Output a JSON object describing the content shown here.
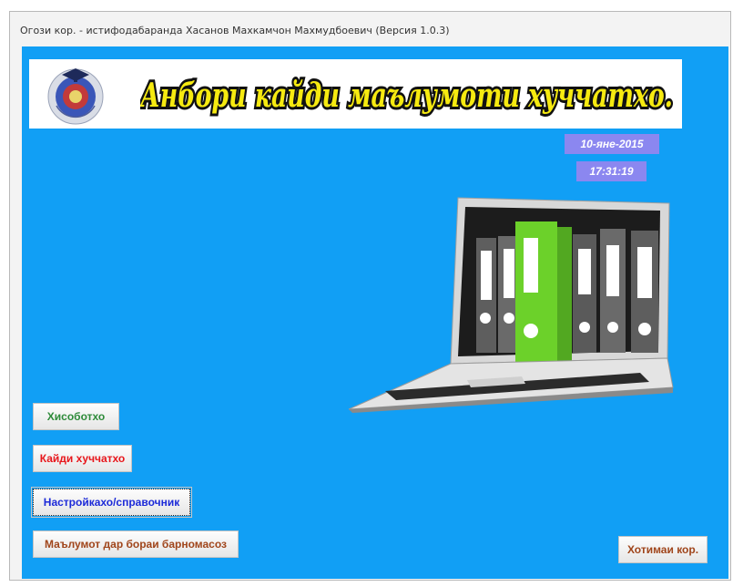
{
  "window": {
    "title": "Огози кор. - истифодабаранда Хасанов Махкамчон Махмудбоевич (Версия 1.0.3)"
  },
  "banner": {
    "title": "Анбори кайди маълумоти хуччатхо."
  },
  "clock": {
    "date": "10-яне-2015",
    "time": "17:31:19"
  },
  "menu": {
    "reports_label": "Хисоботхо",
    "documents_label": "Кайди хуччатхо",
    "settings_label": "Настройкахо/справочник",
    "about_label": "Маълумот дар бораи барномасоз",
    "exit_label": "Хотимаи кор."
  },
  "colors": {
    "form_background": "#119ff5",
    "date_background": "#8b87f0",
    "banner_text": "#f6ea10",
    "reports_text": "#2e8b3a",
    "documents_text": "#e8161b",
    "settings_text": "#1c2ad8",
    "about_text": "#a0451b"
  },
  "icons": {
    "logo": "university-emblem-icon",
    "illustration": "laptop-with-binders-icon"
  }
}
